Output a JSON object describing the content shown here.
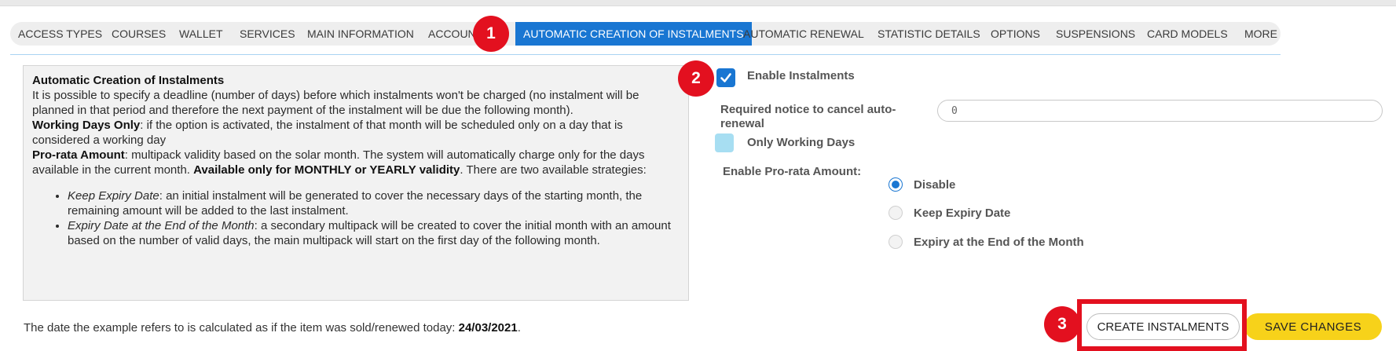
{
  "tabs": [
    {
      "label": "ACCESS TYPES",
      "active": false
    },
    {
      "label": "COURSES",
      "active": false
    },
    {
      "label": "WALLET",
      "active": false
    },
    {
      "label": "SERVICES",
      "active": false
    },
    {
      "label": "MAIN INFORMATION",
      "active": false
    },
    {
      "label": "ACCOUN",
      "active": false
    },
    {
      "label": "AUTOMATIC CREATION OF INSTALMENTS",
      "active": true
    },
    {
      "label": "AUTOMATIC RENEWAL",
      "active": false
    },
    {
      "label": "STATISTIC DETAILS",
      "active": false
    },
    {
      "label": "OPTIONS",
      "active": false
    },
    {
      "label": "SUSPENSIONS",
      "active": false
    },
    {
      "label": "CARD MODELS",
      "active": false
    },
    {
      "label": "MORE",
      "active": false
    }
  ],
  "info": {
    "title": "Automatic Creation of Instalments",
    "intro": "It is possible to specify a deadline (number of days) before which instalments won't be charged (no instalment will be planned in that period and therefore the next payment of the instalment will be due the following month).",
    "working_days_label": "Working Days Only",
    "working_days_text": ": if the option is activated, the instalment of that month will be scheduled only on a day that is considered a working day",
    "prorata_label": "Pro-rata Amount",
    "prorata_text_1": ": multipack validity based on the solar month. The system will automatically charge only for the days available in the current month. ",
    "prorata_bold": "Available only for MONTHLY or YEARLY validity",
    "prorata_text_2": ". There are two available strategies:",
    "bullets": [
      {
        "em": "Keep Expiry Date",
        "text": ": an initial instalment will be generated to cover the necessary days of the starting month, the remaining amount will be added to the last instalment."
      },
      {
        "em": "Expiry Date at the End of the Month",
        "text": ": a secondary multipack will be created to cover the initial month with an amount based on the number of valid days, the main multipack will start on the first day of the following month."
      }
    ]
  },
  "footnote": {
    "text": "The date the example refers to is calculated as if the item was sold/renewed today: ",
    "date": "24/03/2021",
    "end": "."
  },
  "form": {
    "enable_instalments_label": "Enable Instalments",
    "enable_instalments_checked": true,
    "notice_label_1": "Required notice to cancel auto-",
    "notice_label_2": "renewal",
    "notice_value": "0",
    "working_days_label": "Only Working Days",
    "working_days_checked": false,
    "prorata_label": "Enable Pro-rata Amount:",
    "options": [
      {
        "label": "Disable",
        "selected": true
      },
      {
        "label": "Keep Expiry Date",
        "selected": false
      },
      {
        "label": "Expiry at the End of the Month",
        "selected": false
      }
    ]
  },
  "buttons": {
    "create": "CREATE INSTALMENTS",
    "save": "SAVE CHANGES"
  },
  "markers": [
    "1",
    "2",
    "3"
  ],
  "colors": {
    "primary": "#1976d2",
    "annotation_red": "#e3101f",
    "save_yellow": "#f7d21a",
    "checkbox_off": "#a7def2"
  }
}
